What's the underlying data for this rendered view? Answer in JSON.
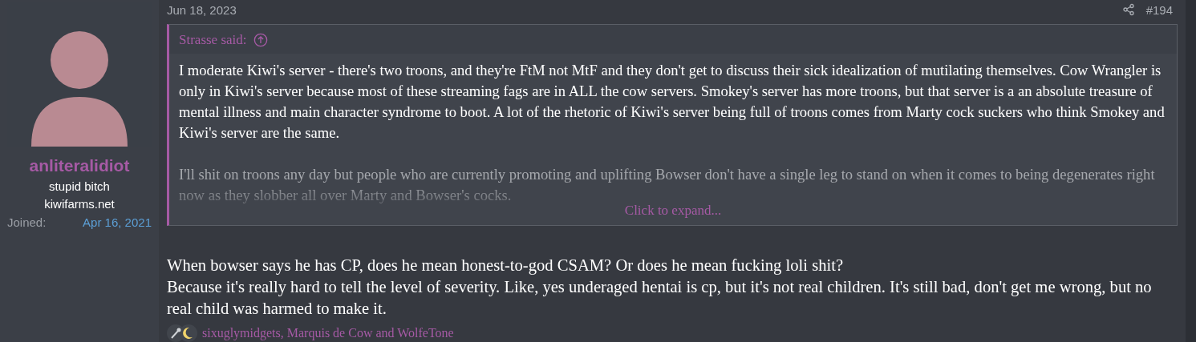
{
  "user": {
    "name": "anliteralidiot",
    "title": "stupid bitch",
    "banner": "kiwifarms.net",
    "joined_label": "Joined:",
    "joined_value": "Apr 16, 2021"
  },
  "post": {
    "date": "Jun 18, 2023",
    "number": "#194",
    "quote": {
      "author": "Strasse said:",
      "paragraphs": [
        "I moderate Kiwi's server - there's two troons, and they're FtM not MtF and they don't get to discuss their sick idealization of mutilating themselves. Cow Wrangler is only in Kiwi's server because most of these streaming fags are in ALL the cow servers. Smokey's server has more troons, but that server is a an absolute treasure of mental illness and main character syndrome to boot. A lot of the rhetoric of Kiwi's server being full of troons comes from Marty cock suckers who think Smokey and Kiwi's server are the same.",
        "I'll shit on troons any day but people who are currently promoting and uplifting Bowser don't have a single leg to stand on when it comes to being degenerates right now as they slobber all over Marty and Bowser's cocks."
      ],
      "expand": "Click to expand...",
      "expanded": false
    },
    "body": [
      "When bowser says he has CP, does he mean honest-to-god CSAM? Or does he mean fucking loli shit?",
      "Because it's really hard to tell the level of severity. Like, yes underaged hentai is cp, but it's not real children. It's still bad, don't get me wrong, but no real child was harmed to make it."
    ],
    "reactions": "sixuglymidgets, Marquis de Cow and WolfeTone"
  }
}
